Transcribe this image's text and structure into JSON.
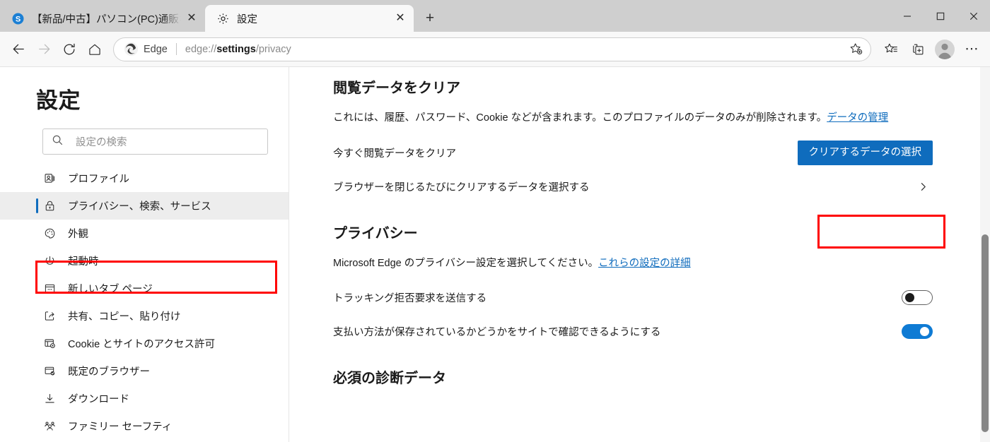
{
  "window": {
    "controls": [
      {
        "name": "minimize",
        "glyph": "─"
      },
      {
        "name": "maximize",
        "glyph": "□"
      },
      {
        "name": "close",
        "glyph": "✕"
      }
    ]
  },
  "tabs": [
    {
      "title": "【新品/中古】パソコン(PC)通販ならソ",
      "favicon": "sofmap-s-icon",
      "active": false,
      "close_glyph": "✕"
    },
    {
      "title": "設定",
      "favicon": "gear-icon",
      "active": true,
      "close_glyph": "✕"
    }
  ],
  "newtab_label": "+",
  "toolbar": {
    "back_label": "←",
    "forward_label": "→",
    "refresh_label": "↻",
    "home_label": "⌂",
    "edge_badge_text": "Edge",
    "url_prefix": "edge://",
    "url_bold": "settings",
    "url_suffix": "/privacy",
    "url_full": "edge://settings/privacy",
    "icons": [
      "favorites-add-icon",
      "favorites-icon",
      "collections-icon",
      "profile-avatar-icon",
      "settings-more-icon"
    ],
    "more_glyph": "⋯"
  },
  "sidebar": {
    "title": "設定",
    "search": {
      "placeholder": "設定の検索",
      "value": "",
      "icon": "search-icon"
    },
    "items": [
      {
        "label": "プロファイル",
        "icon": "profile-icon",
        "selected": false
      },
      {
        "label": "プライバシー、検索、サービス",
        "icon": "lock-icon",
        "selected": true
      },
      {
        "label": "外観",
        "icon": "palette-icon",
        "selected": false
      },
      {
        "label": "起動時",
        "icon": "power-icon",
        "selected": false
      },
      {
        "label": "新しいタブ ページ",
        "icon": "newtab-page-icon",
        "selected": false
      },
      {
        "label": "共有、コピー、貼り付け",
        "icon": "share-icon",
        "selected": false
      },
      {
        "label": "Cookie とサイトのアクセス許可",
        "icon": "cookie-permissions-icon",
        "selected": false
      },
      {
        "label": "既定のブラウザー",
        "icon": "default-browser-icon",
        "selected": false
      },
      {
        "label": "ダウンロード",
        "icon": "download-icon",
        "selected": false
      },
      {
        "label": "ファミリー セーフティ",
        "icon": "family-safety-icon",
        "selected": false
      }
    ]
  },
  "content": {
    "sections": [
      {
        "heading": "閲覧データをクリア",
        "description_prefix": "これには、履歴、パスワード、Cookie などが含まれます。このプロファイルのデータのみが削除されます。",
        "description_link": "データの管理"
      },
      {
        "heading": "プライバシー",
        "description_prefix": "Microsoft Edge のプライバシー設定を選択してください。",
        "description_link": "これらの設定の詳細"
      },
      {
        "heading": "必須の診断データ"
      }
    ],
    "clear_now_row": {
      "label": "今すぐ閲覧データをクリア",
      "button_label": "クリアするデータの選択"
    },
    "on_close_row": {
      "label": "ブラウザーを閉じるたびにクリアするデータを選択する",
      "chevron": "›"
    },
    "toggles": [
      {
        "label": "トラッキング拒否要求を送信する",
        "state": "off"
      },
      {
        "label": "支払い方法が保存されているかどうかをサイトで確認できるようにする",
        "state": "on"
      }
    ]
  },
  "annotations": {
    "color": "#ff0000",
    "boxes": [
      {
        "target": "sidebar-item-privacy"
      },
      {
        "target": "choose-what-to-clear-button"
      }
    ]
  },
  "colors": {
    "accent_blue": "#0f6cbd",
    "toggle_on": "#0f7bd4",
    "annotation_red": "#ff0000",
    "tabstrip_bg": "#cfcfcf",
    "toolbar_bg": "#f8f8f8"
  }
}
